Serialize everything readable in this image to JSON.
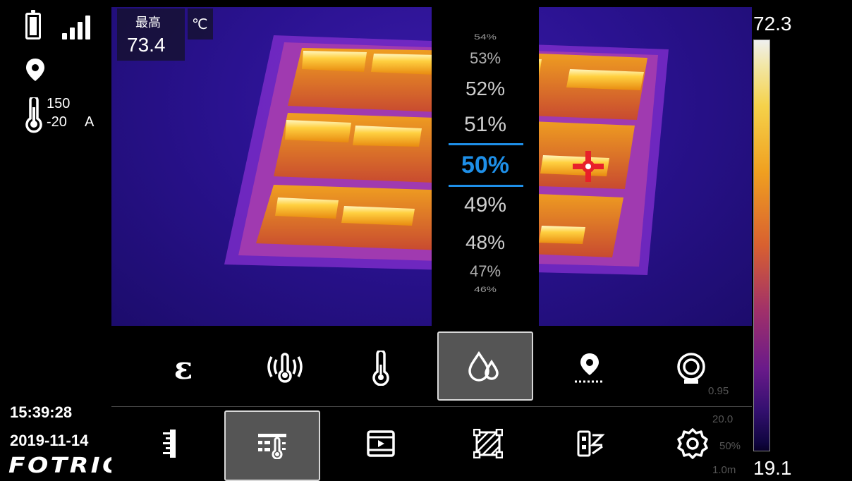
{
  "status": {
    "range_high": "150",
    "range_low": "-20",
    "range_mode": "A",
    "time": "15:39:28",
    "date": "2019-11-14",
    "brand": "FOTRIC"
  },
  "measurement": {
    "max_label": "最高",
    "max_value": "73.4",
    "unit": "℃"
  },
  "color_scale": {
    "max": "72.3",
    "min": "19.1"
  },
  "humidity_picker": {
    "options": [
      "54%",
      "53%",
      "52%",
      "51%",
      "50%",
      "49%",
      "48%",
      "47%",
      "46%"
    ],
    "selected": "50%"
  },
  "top_menu": {
    "items": [
      {
        "name": "emissivity",
        "icon": "epsilon-icon"
      },
      {
        "name": "reflected-temperature",
        "icon": "reflected-temp-icon"
      },
      {
        "name": "ambient-temperature",
        "icon": "thermometer-icon"
      },
      {
        "name": "humidity",
        "icon": "humidity-drops-icon",
        "active": true
      },
      {
        "name": "distance",
        "icon": "distance-pin-icon"
      },
      {
        "name": "lens",
        "icon": "lens-icon"
      }
    ]
  },
  "bottom_menu": {
    "items": [
      {
        "name": "palette-scale",
        "icon": "ruler-icon"
      },
      {
        "name": "measure-parameters",
        "icon": "params-thermo-icon",
        "active": true
      },
      {
        "name": "video",
        "icon": "film-icon"
      },
      {
        "name": "area",
        "icon": "area-hatch-icon"
      },
      {
        "name": "layout",
        "icon": "layout-icon"
      },
      {
        "name": "settings",
        "icon": "gear-icon"
      }
    ]
  },
  "params_overlay": {
    "emissivity": "0.95",
    "reflected_temp": "20.0",
    "humidity": "50%",
    "distance": "1.0m"
  },
  "colors": {
    "accent": "#1e8fe8",
    "crosshair": "#e8202a"
  }
}
